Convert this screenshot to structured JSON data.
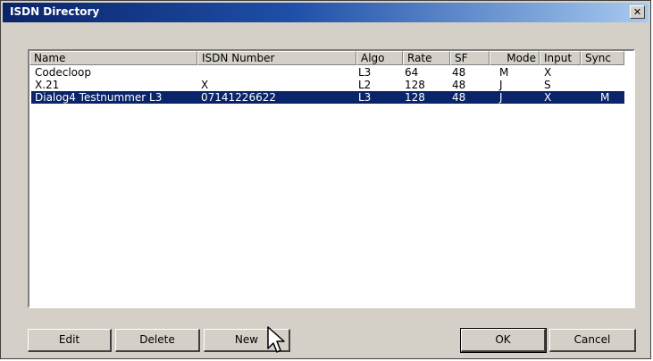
{
  "window": {
    "title": "ISDN Directory",
    "close_glyph": "✕"
  },
  "columns": [
    "Name",
    "ISDN Number",
    "Algo",
    "Rate",
    "SF",
    "Mode",
    "Input",
    "Sync"
  ],
  "rows": [
    {
      "name": "Codecloop",
      "isdn": "",
      "algo": "L3",
      "rate": "64",
      "sf": "48",
      "mode": "M",
      "input": "X",
      "sync": ""
    },
    {
      "name": "X.21",
      "isdn": "X",
      "algo": "L2",
      "rate": "128",
      "sf": "48",
      "mode": "J",
      "input": "S",
      "sync": ""
    },
    {
      "name": "Dialog4 Testnummer L3",
      "isdn": "07141226622",
      "algo": "L3",
      "rate": "128",
      "sf": "48",
      "mode": "J",
      "input": "X",
      "sync": "M"
    }
  ],
  "selected_row": 2,
  "buttons": {
    "edit": "Edit",
    "delete": "Delete",
    "new": "New",
    "ok": "OK",
    "cancel": "Cancel"
  },
  "icons": {
    "close": "close-icon",
    "cursor": "mouse-pointer-icon"
  },
  "colors": {
    "selection": "#0a246a",
    "title_start": "#0a246a",
    "title_end": "#a6caf0"
  }
}
